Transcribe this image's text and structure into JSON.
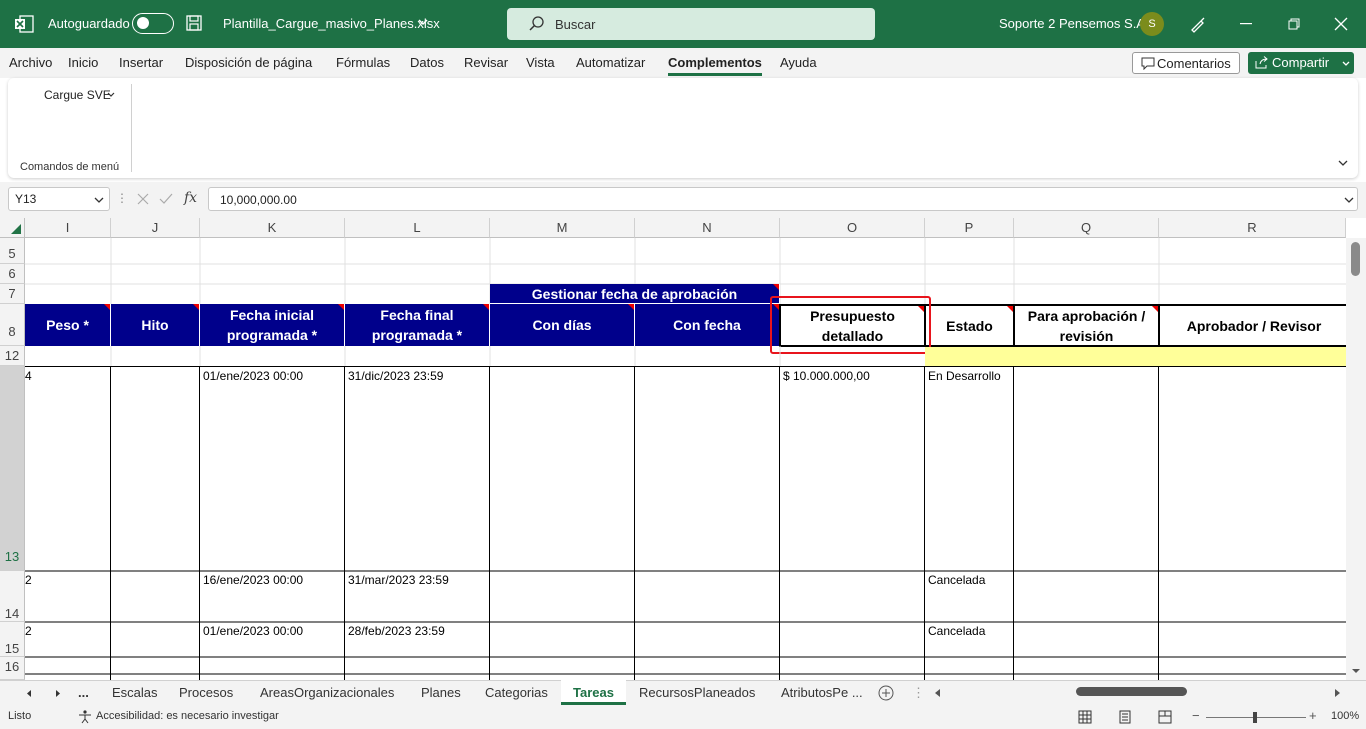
{
  "titlebar": {
    "autosave_label": "Autoguardado",
    "filename": "Plantilla_Cargue_masivo_Planes.xlsx",
    "search_placeholder": "Buscar",
    "user_name": "Soporte 2 Pensemos S.A.",
    "avatar_initial": "S",
    "bg_color": "#1e7145"
  },
  "menu": {
    "items": [
      "Archivo",
      "Inicio",
      "Insertar",
      "Disposición de página",
      "Fórmulas",
      "Datos",
      "Revisar",
      "Vista",
      "Automatizar",
      "Complementos",
      "Ayuda"
    ],
    "active": "Complementos",
    "comments_label": "Comentarios",
    "share_label": "Compartir"
  },
  "ribbon": {
    "dropdown_label": "Cargue SVE",
    "group_label": "Comandos de menú"
  },
  "formula": {
    "name_box": "Y13",
    "fx": "fx",
    "value": "10,000,000.00"
  },
  "columns": [
    "I",
    "J",
    "K",
    "L",
    "M",
    "N",
    "O",
    "P",
    "Q",
    "R"
  ],
  "rows": [
    "5",
    "6",
    "7",
    "8",
    "12",
    "13",
    "14",
    "15",
    "16"
  ],
  "headers": {
    "group_header": "Gestionar fecha de aprobación",
    "peso": "Peso *",
    "hito": "Hito",
    "fecha_inicial_1": "Fecha inicial",
    "fecha_inicial_2": "programada *",
    "fecha_final_1": "Fecha final",
    "fecha_final_2": "programada *",
    "con_dias": "Con días",
    "con_fecha": "Con fecha",
    "presupuesto_1": "Presupuesto",
    "presupuesto_2": "detallado",
    "estado": "Estado",
    "para_aprob_1": "Para aprobación /",
    "para_aprob_2": "revisión",
    "aprobador": "Aprobador / Revisor"
  },
  "data_rows": [
    {
      "row": "13",
      "peso": "4",
      "fecha_inicial": "01/ene/2023 00:00",
      "fecha_final": "31/dic/2023 23:59",
      "presupuesto": "$ 10.000.000,00",
      "estado": "En Desarrollo"
    },
    {
      "row": "14",
      "peso": "2",
      "fecha_inicial": "16/ene/2023 00:00",
      "fecha_final": "31/mar/2023 23:59",
      "presupuesto": "",
      "estado": "Cancelada"
    },
    {
      "row": "15",
      "peso": "2",
      "fecha_inicial": "01/ene/2023 00:00",
      "fecha_final": "28/feb/2023 23:59",
      "presupuesto": "",
      "estado": "Cancelada"
    }
  ],
  "sheet_tabs": [
    "Escalas",
    "Procesos",
    "AreasOrganizacionales",
    "Planes",
    "Categorias",
    "Tareas",
    "RecursosPlaneados",
    "AtributosPe ..."
  ],
  "active_tab": "Tareas",
  "tabs_ellipsis": "...",
  "status": {
    "ready": "Listo",
    "accessibility": "Accesibilidad: es necesario investigar",
    "zoom": "100%"
  }
}
